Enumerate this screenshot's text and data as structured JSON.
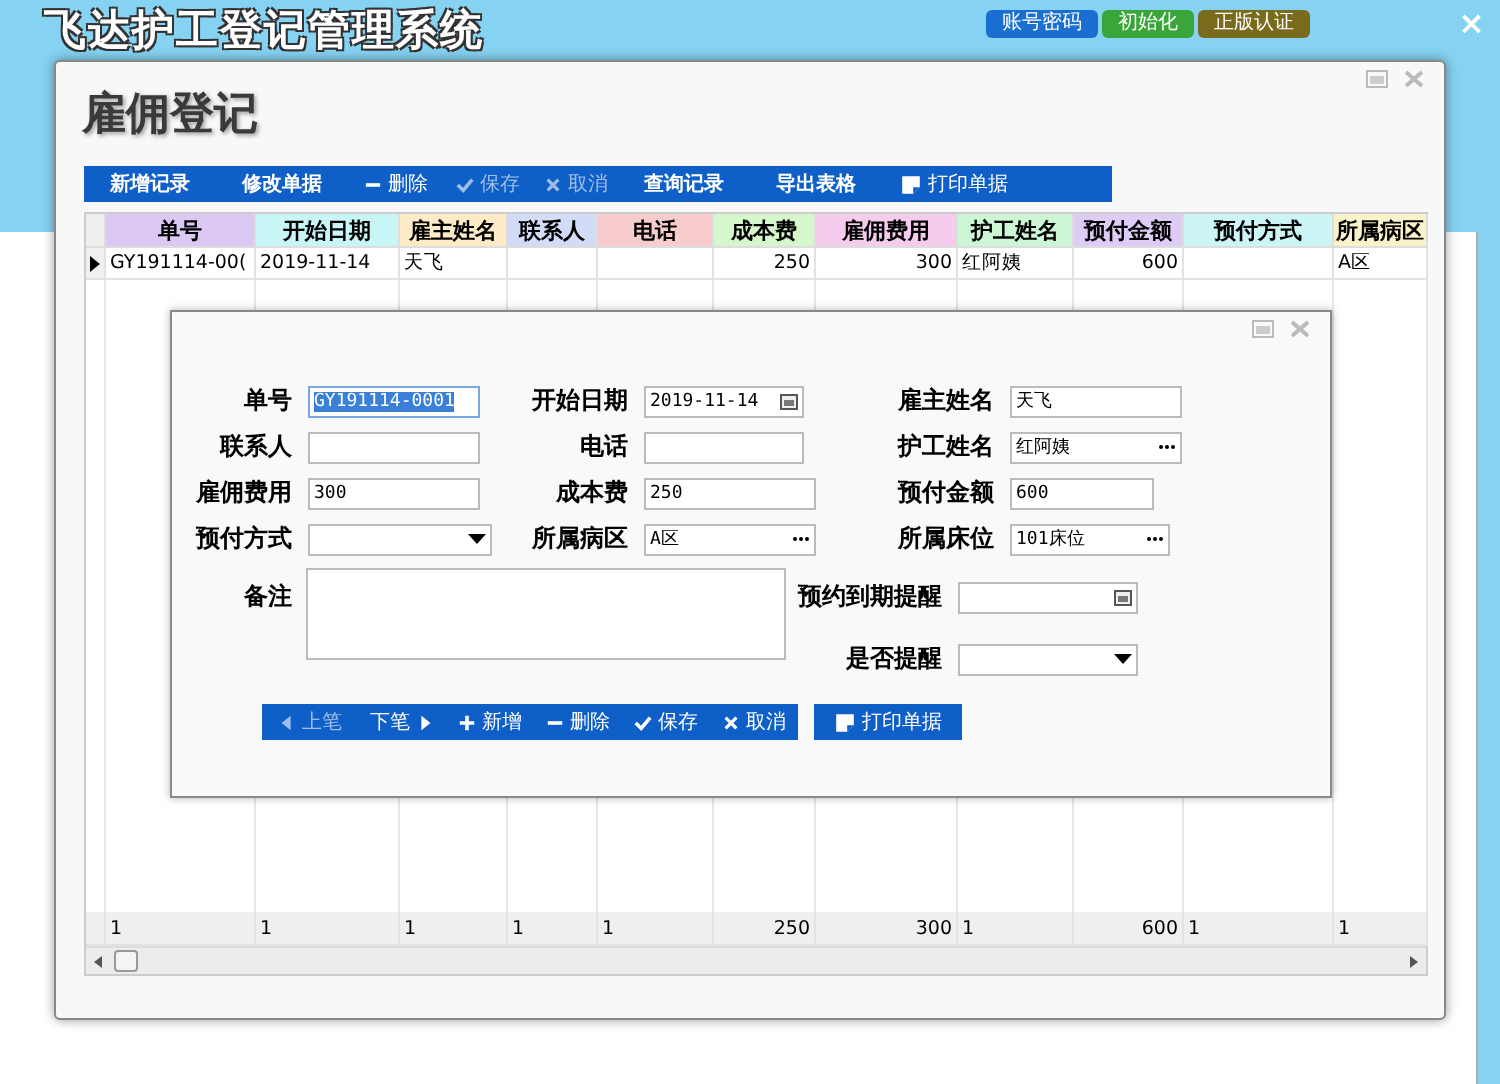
{
  "app": {
    "title": "飞达护工登记管理系统",
    "top_buttons": [
      {
        "label": "账号密码",
        "color": "#1a6fd0"
      },
      {
        "label": "初始化",
        "color": "#3aa63a"
      },
      {
        "label": "正版认证",
        "color": "#7a6a1c"
      }
    ],
    "close": "×"
  },
  "window": {
    "title": "雇佣登记",
    "toolbar": [
      {
        "label": "新增记录",
        "kind": "plain",
        "disabled": false
      },
      {
        "label": "修改单据",
        "kind": "plain",
        "disabled": false
      },
      {
        "label": "删除",
        "kind": "delete",
        "disabled": false
      },
      {
        "label": "保存",
        "kind": "save",
        "disabled": true
      },
      {
        "label": "取消",
        "kind": "cancel",
        "disabled": true
      },
      {
        "label": "查询记录",
        "kind": "plain",
        "disabled": false
      },
      {
        "label": "导出表格",
        "kind": "plain",
        "disabled": false
      },
      {
        "label": "打印单据",
        "kind": "print",
        "disabled": false
      }
    ],
    "table": {
      "columns": [
        {
          "label": "单号",
          "color": "#dcc8f4",
          "kind": "text"
        },
        {
          "label": "开始日期",
          "color": "#c8f6f6",
          "kind": "text"
        },
        {
          "label": "雇主姓名",
          "color": "#fcebc4",
          "kind": "text"
        },
        {
          "label": "联系人",
          "color": "#d2dcf6",
          "kind": "text"
        },
        {
          "label": "电话",
          "color": "#f8cccc",
          "kind": "text"
        },
        {
          "label": "成本费",
          "color": "#d6f6cc",
          "kind": "number"
        },
        {
          "label": "雇佣费用",
          "color": "#f6ccee",
          "kind": "number"
        },
        {
          "label": "护工姓名",
          "color": "#ccf6d4",
          "kind": "text"
        },
        {
          "label": "预付金额",
          "color": "#dcccf6",
          "kind": "number"
        },
        {
          "label": "预付方式",
          "color": "#ccf6f6",
          "kind": "text"
        },
        {
          "label": "所属病区",
          "color": "#faf2c8",
          "kind": "text"
        }
      ],
      "rows": [
        {
          "selected": true,
          "cells": [
            "GY191114-00(",
            "2019-11-14",
            "天飞",
            "",
            "",
            "250",
            "300",
            "红阿姨",
            "600",
            "",
            "A区"
          ]
        }
      ],
      "totals": [
        "1",
        "1",
        "1",
        "1",
        "1",
        "250",
        "300",
        "1",
        "600",
        "1",
        "1"
      ]
    }
  },
  "dialog": {
    "fields": [
      {
        "label": "单号",
        "value": "GY191114-0001",
        "kind": "text",
        "selected": true
      },
      {
        "label": "开始日期",
        "value": "2019-11-14",
        "kind": "date",
        "selected": false
      },
      {
        "label": "雇主姓名",
        "value": "天飞",
        "kind": "text",
        "selected": false
      },
      {
        "label": "联系人",
        "kind": "text",
        "selected": false
      },
      {
        "label": "电话",
        "kind": "text",
        "selected": false
      },
      {
        "label": "护工姓名",
        "value": "红阿姨",
        "kind": "lookup",
        "selected": false
      },
      {
        "label": "雇佣费用",
        "value": "300",
        "kind": "text",
        "selected": false
      },
      {
        "label": "成本费",
        "value": "250",
        "kind": "text",
        "selected": false
      },
      {
        "label": "预付金额",
        "value": "600",
        "kind": "text",
        "selected": false
      },
      {
        "label": "预付方式",
        "kind": "select",
        "selected": false
      },
      {
        "label": "所属病区",
        "value": "A区",
        "kind": "lookup",
        "selected": false
      },
      {
        "label": "所属床位",
        "value": "101床位",
        "kind": "lookup",
        "selected": false
      }
    ],
    "remarks": {
      "label": "备注"
    },
    "side_fields": [
      {
        "label": "预约到期提醒",
        "kind": "date",
        "selected": false
      },
      {
        "label": "是否提醒",
        "kind": "select",
        "selected": false
      }
    ],
    "nav": [
      {
        "label": "上笔",
        "kind": "prev",
        "disabled": true
      },
      {
        "label": "下笔",
        "kind": "next",
        "disabled": false
      },
      {
        "label": "新增",
        "kind": "add",
        "disabled": false
      },
      {
        "label": "删除",
        "kind": "delete",
        "disabled": false
      },
      {
        "label": "保存",
        "kind": "save",
        "disabled": false
      },
      {
        "label": "取消",
        "kind": "cancel",
        "disabled": false
      }
    ],
    "print": {
      "label": "打印单据",
      "kind": "print",
      "disabled": false
    }
  }
}
